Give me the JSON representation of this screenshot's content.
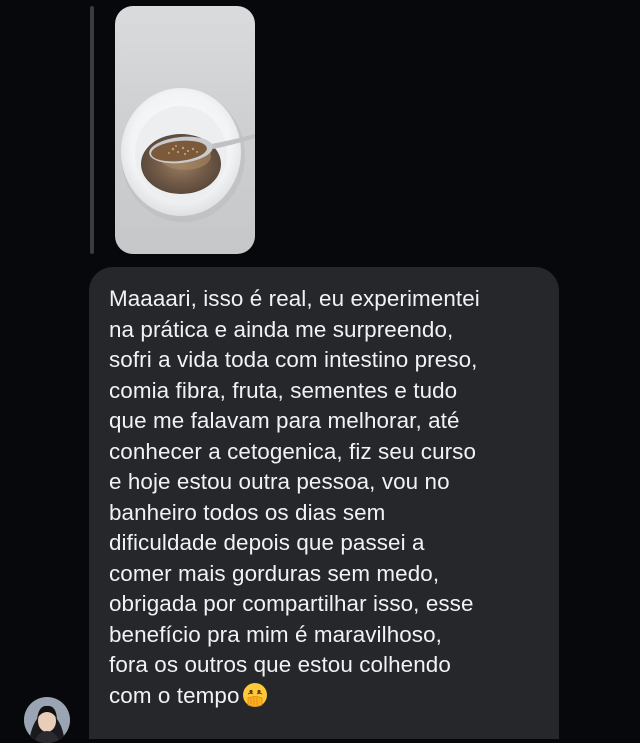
{
  "shared_media": {
    "type": "photo",
    "subject": "spoon-in-bowl"
  },
  "message": {
    "text": "Maaaari, isso é real, eu experimentei\nna prática e ainda me surpreendo,\nsofri a vida toda com intestino preso,\ncomia fibra, fruta, sementes e tudo\nque me falavam para melhorar, até\nconhecer a cetogenica, fiz seu curso\ne hoje estou outra pessoa, vou no\nbanheiro todos os dias sem\ndificuldade depois que passei a\ncomer mais gorduras sem medo,\nobrigada por compartilhar isso, esse\nbenefício pra mim é maravilhoso,\nfora os outros que estou colhendo\ncom o tempo",
    "emoji": "hand-over-mouth-emoji"
  },
  "sender": {
    "avatar": "profile-avatar"
  },
  "colors": {
    "background": "#07080b",
    "bubble": "#26272b",
    "text": "#f2f2f4",
    "reply_bar": "#3a3b40"
  }
}
